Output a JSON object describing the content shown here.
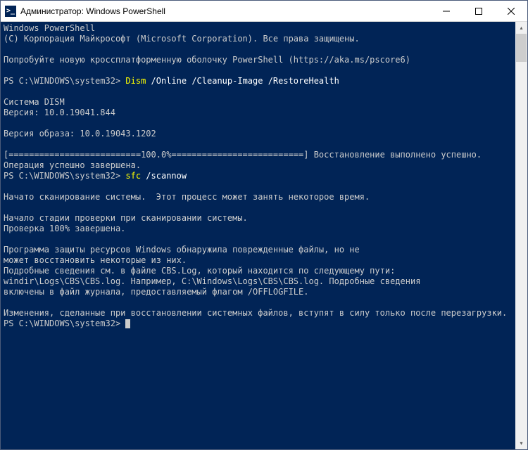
{
  "window": {
    "title": "Администратор: Windows PowerShell",
    "icon_text": ">_"
  },
  "console": {
    "header_line1": "Windows PowerShell",
    "header_line2": "(C) Корпорация Майкрософт (Microsoft Corporation). Все права защищены.",
    "try_line": "Попробуйте новую кроссплатформенную оболочку PowerShell (https://aka.ms/pscore6)",
    "prompt1_path": "PS C:\\WINDOWS\\system32> ",
    "prompt1_cmd": "Dism",
    "prompt1_args": " /Online /Cleanup-Image /RestoreHealth",
    "dism_system": "Cистема DISM",
    "dism_version": "Версия: 10.0.19041.844",
    "image_version": "Версия образа: 10.0.19043.1202",
    "progress_line": "[==========================100.0%==========================] Восстановление выполнено успешно.",
    "operation_done": "Операция успешно завершена.",
    "prompt2_path": "PS C:\\WINDOWS\\system32> ",
    "prompt2_cmd": "sfc",
    "prompt2_args": " /scannow",
    "scan_start": "Начато сканирование системы.  Этот процесс может занять некоторое время.",
    "scan_stage": "Начало стадии проверки при сканировании системы.",
    "scan_complete": "Проверка 100% завершена.",
    "result_line1": "Программа защиты ресурсов Windows обнаружила поврежденные файлы, но не",
    "result_line2": "может восстановить некоторые из них.",
    "result_line3": "Подробные сведения см. в файле CBS.Log, который находится по следующему пути:",
    "result_line4": "windir\\Logs\\CBS\\CBS.log. Например, C:\\Windows\\Logs\\CBS\\CBS.log. Подробные сведения",
    "result_line5": "включены в файл журнала, предоставляемый флагом /OFFLOGFILE.",
    "changes_line": "Изменения, сделанные при восстановлении системных файлов, вступят в силу только после перезагрузки.",
    "prompt3_path": "PS C:\\WINDOWS\\system32> "
  }
}
